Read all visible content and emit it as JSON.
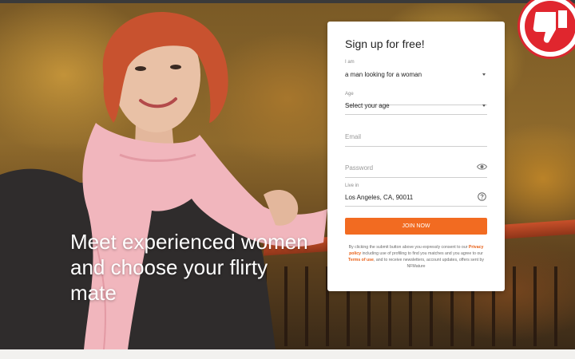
{
  "hero": {
    "tagline_line1": "Meet experienced women",
    "tagline_line2": "and choose your flirty",
    "tagline_line3": "mate"
  },
  "signup": {
    "title": "Sign up for free!",
    "i_am_label": "I am",
    "i_am_value": "a man looking for a woman",
    "age_label": "Age",
    "age_value": "Select your age",
    "email_placeholder": "Email",
    "password_placeholder": "Password",
    "location_label": "Live in",
    "location_value": "Los Angeles, CA, 90011",
    "location_help_icon": "question-circle-icon",
    "password_toggle_icon": "eye-icon",
    "join_label": "JOIN NOW",
    "legal_part1": "By clicking the submit button above you expressly consent to our",
    "legal_privacy": "Privacy policy",
    "legal_part2": "including use of profiling to find you matches and you agree to our",
    "legal_terms": "Terms of use",
    "legal_part3": ", and to receive newsletters, account updates, offers sent by NFMature"
  },
  "badge": {
    "icon": "thumbs-down-icon"
  },
  "colors": {
    "accent": "#f26b21",
    "badge": "#e0262e",
    "link": "#e85f16"
  }
}
